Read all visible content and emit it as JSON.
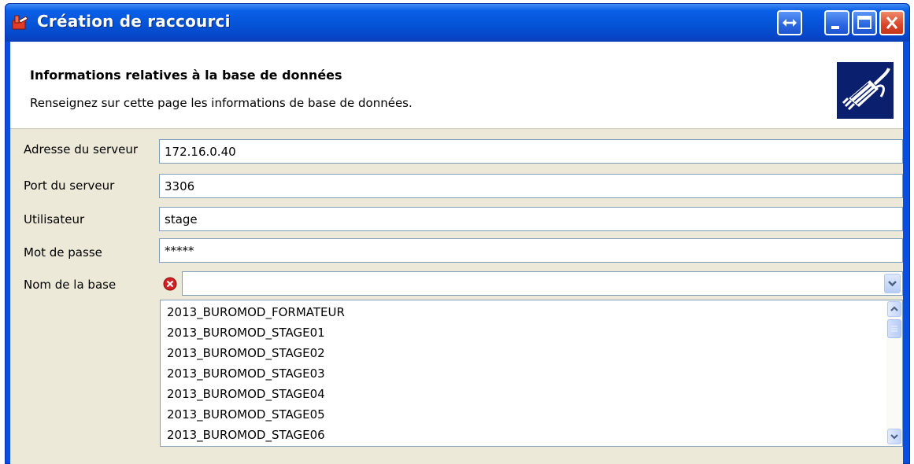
{
  "window": {
    "title": "Création de raccourci",
    "buttons": [
      "resize",
      "minimize",
      "maximize",
      "close"
    ]
  },
  "header": {
    "title": "Informations relatives à la base de données",
    "subtitle": "Renseignez sur cette page les informations de base de données.",
    "icon": "connector-plug-icon"
  },
  "form": {
    "server_address_label": "Adresse du serveur",
    "server_address_value": "172.16.0.40",
    "server_port_label": "Port du serveur",
    "server_port_value": "3306",
    "user_label": "Utilisateur",
    "user_value": "stage",
    "password_label": "Mot de passe",
    "password_value": "*****",
    "database_label": "Nom de la base",
    "database_value": "",
    "database_error_icon": "error-icon"
  },
  "database_list": {
    "items": [
      "2013_BUROMOD_FORMATEUR",
      "2013_BUROMOD_STAGE01",
      "2013_BUROMOD_STAGE02",
      "2013_BUROMOD_STAGE03",
      "2013_BUROMOD_STAGE04",
      "2013_BUROMOD_STAGE05",
      "2013_BUROMOD_STAGE06"
    ]
  },
  "colors": {
    "titlebar": "#0553d6",
    "client_background": "#ece9d8",
    "field_border": "#7f9db9",
    "error": "#d32020"
  }
}
